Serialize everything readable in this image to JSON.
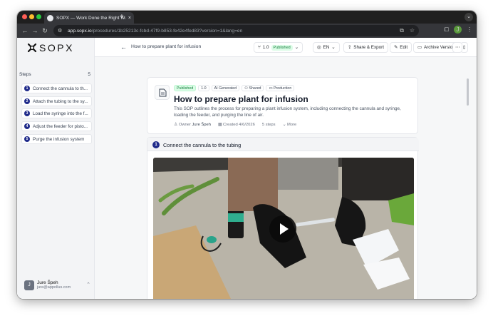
{
  "browser": {
    "tab_title": "SOPX — Work Done the Right Way",
    "tab_close": "×",
    "new_tab": "+",
    "url_host": "app.sopx.io",
    "url_path": "/procedures/1b25213c-fcbd-47f9-b853-fe42e4fed83?version=1&lang=en",
    "profile_initial": "J"
  },
  "sidebar": {
    "logo_text": "SOPX",
    "steps_label": "Steps",
    "steps_count": "5",
    "steps": [
      {
        "num": "1",
        "label": "Connect the cannula to th..."
      },
      {
        "num": "2",
        "label": "Attach the tubing to the sy..."
      },
      {
        "num": "3",
        "label": "Load the syringe into the f..."
      },
      {
        "num": "4",
        "label": "Adjust the feeder for pisto..."
      },
      {
        "num": "5",
        "label": "Purge the infusion system"
      }
    ],
    "user": {
      "initial": "J",
      "name": "Jure Špeh",
      "email": "jure@appollus.com"
    }
  },
  "header": {
    "title": "How to prepare plant for infusion",
    "version": "1.0",
    "version_status": "Published",
    "language": "EN",
    "share_label": "Share & Export",
    "edit_label": "Edit",
    "archive_label": "Archive Version"
  },
  "sop": {
    "badges": [
      "Published",
      "1.0",
      "AI Generated",
      "Shared",
      "Production"
    ],
    "title": "How to prepare plant for infusion",
    "description": "This SOP outlines the process for preparing a plant infusion system, including connecting the cannula and syringe, loading the feeder, and purging the line of air.",
    "owner_label": "Owner",
    "owner": "Jure Špeh",
    "created": "Created 4/6/2026",
    "steps": "5 steps",
    "more": "More"
  },
  "current_step": {
    "num": "1",
    "title": "Connect the cannula to the tubing"
  },
  "colors": {
    "accent": "#1f2a8a",
    "published_bg": "#dcfce7",
    "published_text": "#15803d"
  }
}
